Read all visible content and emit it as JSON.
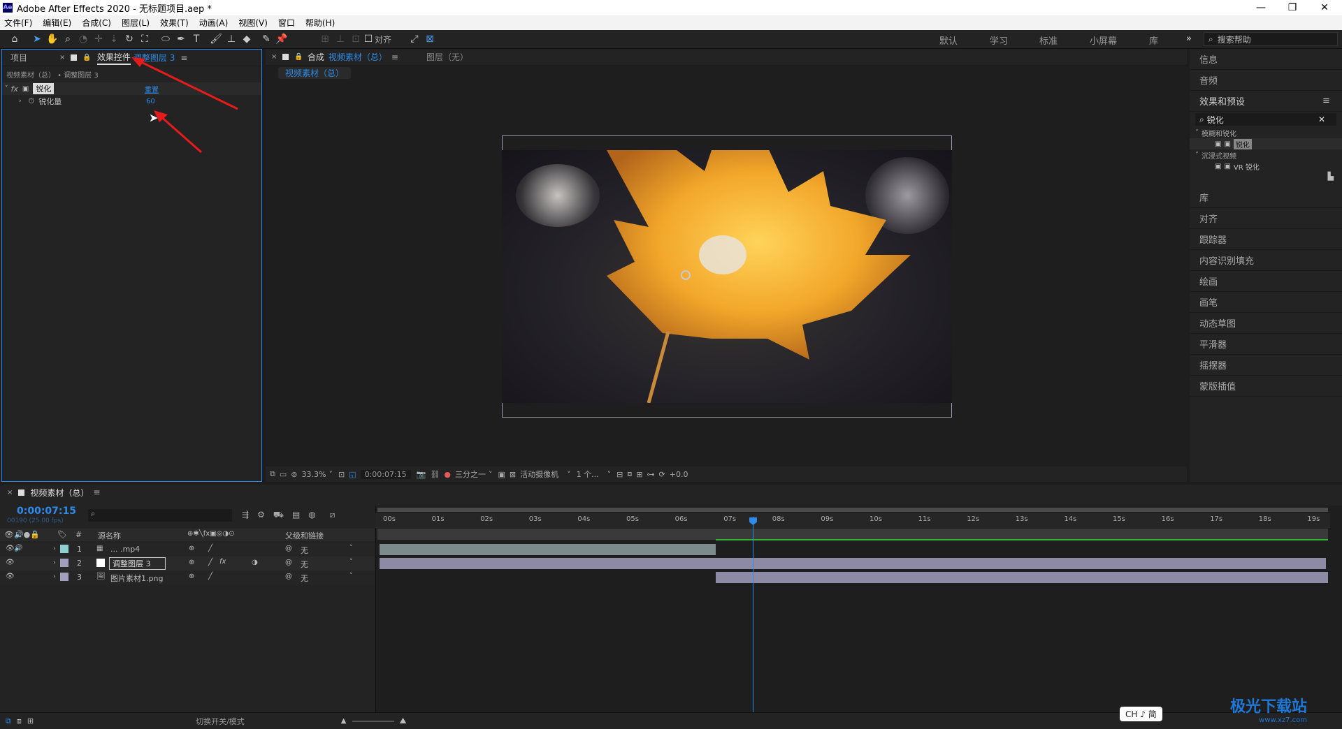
{
  "window": {
    "app_icon": "Ae",
    "title": "Adobe After Effects 2020 - 无标题项目.aep *"
  },
  "menu": [
    "文件(F)",
    "编辑(E)",
    "合成(C)",
    "图层(L)",
    "效果(T)",
    "动画(A)",
    "视图(V)",
    "窗口",
    "帮助(H)"
  ],
  "toolbar": {
    "align_label": "对齐",
    "workspaces": [
      "默认",
      "学习",
      "标准",
      "小屏幕",
      "库"
    ],
    "help_search_placeholder": "搜索帮助"
  },
  "left_panel": {
    "tab_project": "项目",
    "tab_effects": "效果控件",
    "tab_effects_layer": "调整图层 3",
    "breadcrumb": "视频素材（总） • 调整图层 3",
    "effect_name": "锐化",
    "reset_label": "重置",
    "param_name": "锐化量",
    "param_value": "60"
  },
  "comp_panel": {
    "tab_comp_prefix": "合成",
    "tab_comp_name": "视频素材（总）",
    "tab_layer": "图层（无）",
    "subtab": "视频素材（总）"
  },
  "viewer_bar": {
    "zoom": "33.3%",
    "timecode": "0:00:07:15",
    "grid": "三分之一",
    "camera": "活动摄像机",
    "views": "1 个...",
    "exposure": "+0.0"
  },
  "right_panel": {
    "info": "信息",
    "audio": "音频",
    "effects_presets": "效果和预设",
    "search_value": "锐化",
    "group1": "模糊和锐化",
    "item1": "锐化",
    "group2": "沉浸式视频",
    "item2": "VR 锐化",
    "sections": [
      "库",
      "对齐",
      "跟踪器",
      "内容识别填充",
      "绘画",
      "画笔",
      "动态草图",
      "平滑器",
      "摇摆器",
      "蒙版插值"
    ]
  },
  "timeline": {
    "tab_name": "视频素材（总）",
    "timecode": "0:00:07:15",
    "frame_info": "00190 (25.00 fps)",
    "col_source": "源名称",
    "col_parent": "父级和链接",
    "rows": [
      {
        "num": "1",
        "name": "... .mp4",
        "parent": "无"
      },
      {
        "num": "2",
        "name": "调整图层 3",
        "parent": "无"
      },
      {
        "num": "3",
        "name": "图片素材1.png",
        "parent": "无"
      }
    ],
    "ruler": [
      "00s",
      "01s",
      "02s",
      "03s",
      "04s",
      "05s",
      "06s",
      "07s",
      "08s",
      "09s",
      "10s",
      "11s",
      "12s",
      "13s",
      "14s",
      "15s",
      "16s",
      "17s",
      "18s",
      "19s"
    ],
    "toggle_label": "切换开关/模式",
    "playhead_seconds": 7.6,
    "duration_seconds": 20
  },
  "ime": "CH ♪ 简",
  "watermark": "极光下载站",
  "watermark_url": "www.xz7.com",
  "colors": {
    "accent_blue": "#2d8ceb",
    "label_lavender": "#a29ec0",
    "clip_gray": "#6e7a8a",
    "arrow_red": "#e61b1b"
  }
}
